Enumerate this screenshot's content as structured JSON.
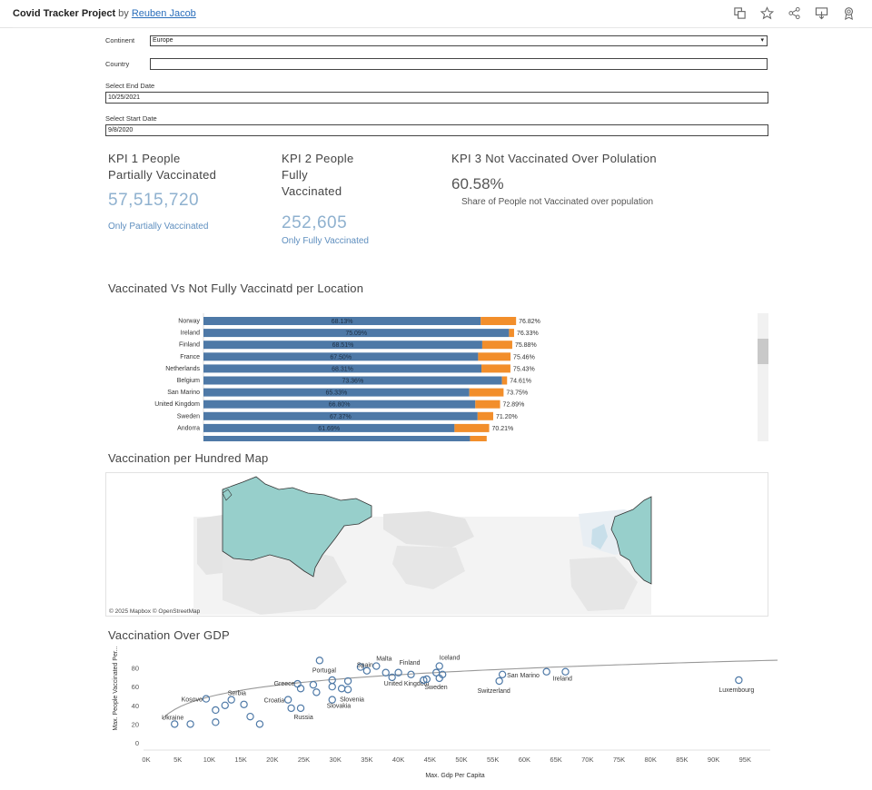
{
  "header": {
    "title": "Covid Tracker Project",
    "by": "by",
    "author": "Reuben Jacob",
    "icons": [
      "duplicate-icon",
      "star-icon",
      "share-icon",
      "download-icon",
      "badge-icon"
    ]
  },
  "filters": {
    "continent_label": "Continent",
    "continent_value": "Europe",
    "country_label": "Country",
    "country_value": "",
    "end_date_label": "Select End Date",
    "end_date_value": "10/25/2021",
    "start_date_label": "Select Start Date",
    "start_date_value": "9/8/2020"
  },
  "kpis": {
    "kpi1_title_line1": "KPI 1 People",
    "kpi1_title_line2": "Partially Vaccinated",
    "kpi1_value": "57,515,720",
    "kpi1_sub": "Only Partially Vaccinated",
    "kpi2_title_line1": "KPI 2 People",
    "kpi2_title_line2": "Fully",
    "kpi2_title_line3": "Vaccinated",
    "kpi2_value": "252,605",
    "kpi2_sub": "Only Fully Vaccinated",
    "kpi3_title": "KPI 3 Not Vaccinated Over Polulation",
    "kpi3_value": "60.58%",
    "kpi3_sub": "Share of People not Vaccinated over population"
  },
  "sections": {
    "bar_title": "Vaccinated Vs Not Fully Vaccinatd per Location",
    "map_title": "Vaccination per Hundred Map",
    "map_credit": "© 2025 Mapbox © OpenStreetMap",
    "scatter_title": "Vaccination Over GDP"
  },
  "colors": {
    "bar_blue": "#4e79a7",
    "bar_orange": "#f28e2b",
    "map_fill": "#9fd3d1",
    "map_land": "#e6e6e6",
    "point": "#4e79a7",
    "trend": "#999999"
  },
  "chart_data": [
    {
      "type": "bar",
      "title": "Vaccinated Vs Not Fully Vaccinatd per Location",
      "ylabel": "Location",
      "categories": [
        "Norway",
        "Ireland",
        "Finland",
        "France",
        "Netherlands",
        "Belgium",
        "San Marino",
        "United Kingdom",
        "Sweden",
        "Andorra"
      ],
      "series": [
        {
          "values": [
            68.13,
            75.09,
            68.51,
            67.5,
            68.31,
            73.36,
            65.33,
            66.8,
            67.37,
            61.69
          ]
        },
        {
          "values": [
            76.82,
            76.33,
            75.88,
            75.46,
            75.43,
            74.61,
            73.75,
            72.89,
            71.2,
            70.21
          ]
        }
      ],
      "xlim": [
        0,
        100
      ]
    },
    {
      "type": "scatter",
      "title": "Vaccination Over GDP",
      "xlabel": "Max. Gdp Per Capita",
      "ylabel": "Max. People Vaccinated Per Hundred",
      "xlim": [
        0,
        100000
      ],
      "ylim": [
        0,
        90
      ],
      "xticks": [
        "0K",
        "5K",
        "10K",
        "15K",
        "20K",
        "25K",
        "30K",
        "35K",
        "40K",
        "45K",
        "50K",
        "55K",
        "60K",
        "65K",
        "70K",
        "75K",
        "80K",
        "85K",
        "90K",
        "95K"
      ],
      "yticks": [
        "0",
        "20",
        "40",
        "60",
        "80"
      ],
      "points": [
        {
          "label": "Ukraine",
          "x": 4500,
          "y": 20
        },
        {
          "x": 7000,
          "y": 20
        },
        {
          "label": "Kosovo",
          "x": 9500,
          "y": 47
        },
        {
          "x": 11000,
          "y": 35
        },
        {
          "x": 11000,
          "y": 22
        },
        {
          "x": 12500,
          "y": 40
        },
        {
          "label": "Serbia",
          "x": 13500,
          "y": 46
        },
        {
          "x": 15500,
          "y": 41
        },
        {
          "x": 16500,
          "y": 28
        },
        {
          "x": 18000,
          "y": 20
        },
        {
          "label": "Croatia",
          "x": 22500,
          "y": 46
        },
        {
          "x": 23000,
          "y": 37
        },
        {
          "label": "Greece",
          "x": 24000,
          "y": 63
        },
        {
          "x": 24500,
          "y": 58
        },
        {
          "label": "Russia",
          "x": 24500,
          "y": 37
        },
        {
          "x": 26500,
          "y": 62
        },
        {
          "x": 27000,
          "y": 54
        },
        {
          "label": "Portugal",
          "x": 27500,
          "y": 88
        },
        {
          "x": 29500,
          "y": 60
        },
        {
          "x": 29500,
          "y": 67
        },
        {
          "label": "Slovakia",
          "x": 29500,
          "y": 46
        },
        {
          "x": 31000,
          "y": 58
        },
        {
          "label": "Slovenia",
          "x": 32000,
          "y": 57
        },
        {
          "x": 32000,
          "y": 66
        },
        {
          "x": 34000,
          "y": 81
        },
        {
          "label": "Spain",
          "x": 35000,
          "y": 77
        },
        {
          "label": "Malta",
          "x": 36500,
          "y": 82
        },
        {
          "x": 38000,
          "y": 75
        },
        {
          "label": "United Kingdom",
          "x": 39000,
          "y": 70
        },
        {
          "label": "Finland",
          "x": 40000,
          "y": 75
        },
        {
          "x": 42000,
          "y": 73
        },
        {
          "label": "Sweden",
          "x": 44000,
          "y": 67
        },
        {
          "x": 44500,
          "y": 68
        },
        {
          "label": "Iceland",
          "x": 46500,
          "y": 82
        },
        {
          "x": 46000,
          "y": 75
        },
        {
          "x": 46500,
          "y": 69
        },
        {
          "x": 47000,
          "y": 73
        },
        {
          "label": "Switzerland",
          "x": 56000,
          "y": 66
        },
        {
          "label": "San Marino",
          "x": 56500,
          "y": 73
        },
        {
          "x": 63500,
          "y": 76
        },
        {
          "label": "Ireland",
          "x": 66500,
          "y": 76
        },
        {
          "label": "Luxembourg",
          "x": 94000,
          "y": 67
        }
      ]
    }
  ]
}
